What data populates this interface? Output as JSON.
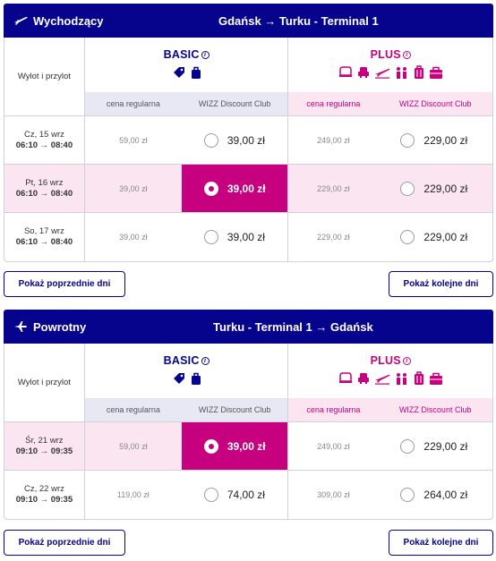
{
  "colors": {
    "brand": "#06038d",
    "accent": "#c6007e"
  },
  "outbound": {
    "direction": "Wychodzący",
    "route": "Gdańsk → Turku - Terminal 1",
    "date_col_label": "Wylot i przylot",
    "basic_title": "BASIC",
    "plus_title": "PLUS",
    "basic_icons": [
      "tag-icon",
      "bag-icon"
    ],
    "plus_icons": [
      "seat-icon",
      "priority-seat-icon",
      "plane-icon",
      "people-icon",
      "suitcase-icon",
      "cabin-bag-icon"
    ],
    "reg_label": "cena regularna",
    "club_label": "WIZZ Discount Club",
    "rows": [
      {
        "date": "Cz, 15 wrz",
        "time": "06:10 → 08:40",
        "basic_reg": "59,00 zł",
        "basic_club": "39,00 zł",
        "plus_reg": "249,00 zł",
        "plus_club": "229,00 zł",
        "selected": false
      },
      {
        "date": "Pt, 16 wrz",
        "time": "06:10 → 08:40",
        "basic_reg": "39,00 zł",
        "basic_club": "39,00 zł",
        "plus_reg": "229,00 zł",
        "plus_club": "229,00 zł",
        "selected": true
      },
      {
        "date": "So, 17 wrz",
        "time": "06:10 → 08:40",
        "basic_reg": "39,00 zł",
        "basic_club": "39,00 zł",
        "plus_reg": "229,00 zł",
        "plus_club": "229,00 zł",
        "selected": false
      }
    ],
    "prev_label": "Pokaż poprzednie dni",
    "next_label": "Pokaż kolejne dni"
  },
  "return": {
    "direction": "Powrotny",
    "route": "Turku - Terminal 1 → Gdańsk",
    "date_col_label": "Wylot i przylot",
    "basic_title": "BASIC",
    "plus_title": "PLUS",
    "reg_label": "cena regularna",
    "club_label": "WIZZ Discount Club",
    "rows": [
      {
        "date": "Śr, 21 wrz",
        "time": "09:10 → 09:35",
        "basic_reg": "59,00 zł",
        "basic_club": "39,00 zł",
        "plus_reg": "249,00 zł",
        "plus_club": "229,00 zł",
        "selected": true
      },
      {
        "date": "Cz, 22 wrz",
        "time": "09:10 → 09:35",
        "basic_reg": "119,00 zł",
        "basic_club": "74,00 zł",
        "plus_reg": "309,00 zł",
        "plus_club": "264,00 zł",
        "selected": false
      }
    ],
    "prev_label": "Pokaż poprzednie dni",
    "next_label": "Pokaż kolejne dni"
  }
}
